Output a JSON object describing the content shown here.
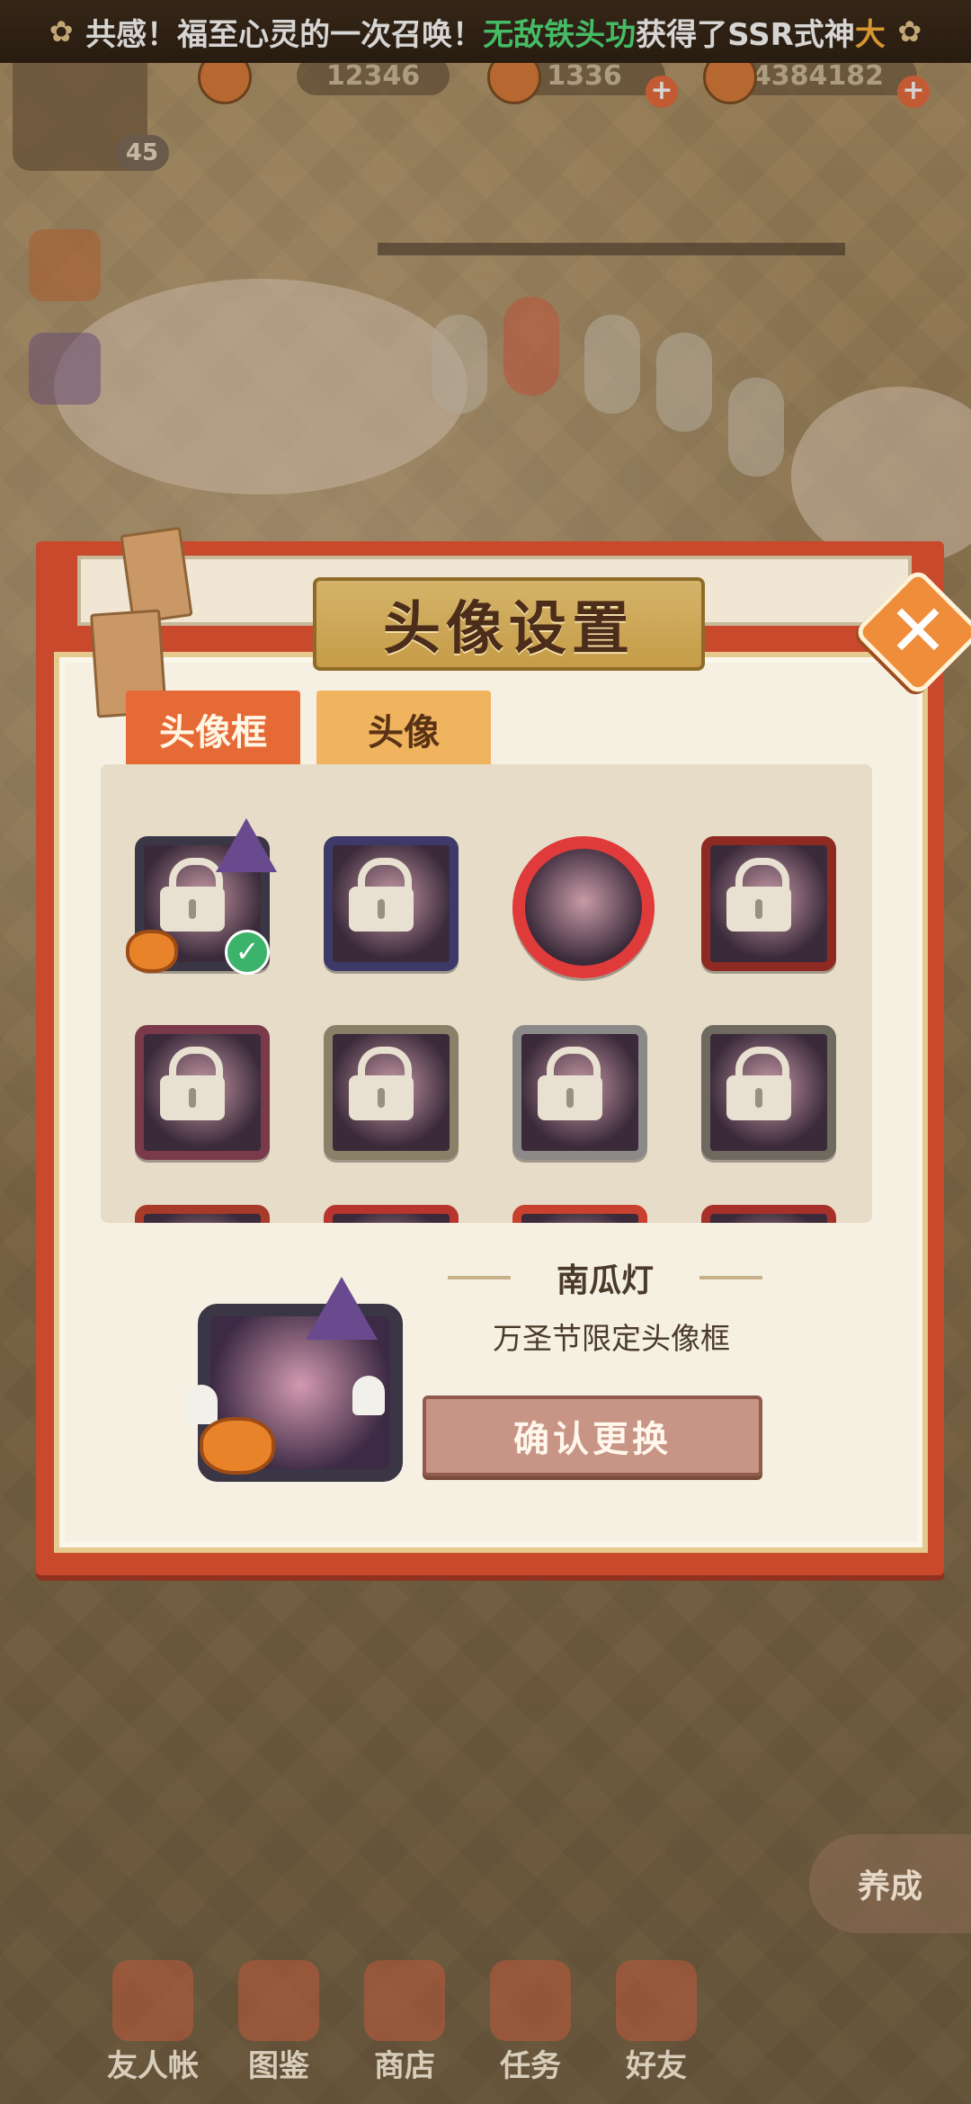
{
  "ticker": {
    "part1": "共感！福至心灵的一次召唤！",
    "player": "无敌铁头功",
    "part2": "获得了SSR式神",
    "tail": "大"
  },
  "resources": {
    "currency1": "12346",
    "currency2": "1336",
    "currency3": "4384182",
    "level": "45"
  },
  "modal": {
    "title": "头像设置",
    "close_symbol": "✕",
    "tabs": [
      "头像框",
      "头像"
    ],
    "active_tab": "头像框",
    "selected_item": {
      "name": "南瓜灯",
      "description": "万圣节限定头像框"
    },
    "confirm_label": "确认更换"
  },
  "bottom_nav": {
    "items": [
      {
        "label": "友人帐",
        "icon": "book-icon"
      },
      {
        "label": "图鉴",
        "icon": "eye-icon"
      },
      {
        "label": "商店",
        "icon": "cat-icon"
      },
      {
        "label": "任务",
        "icon": "task-icon"
      },
      {
        "label": "好友",
        "icon": "friends-icon"
      }
    ],
    "side_button": "养成"
  },
  "colors": {
    "tab_active": "#e66a36",
    "tab_inactive": "#f0b35e",
    "panel_bg": "#f6f0e2",
    "modal_red": "#c8492c",
    "check_green": "#3cb36a"
  }
}
